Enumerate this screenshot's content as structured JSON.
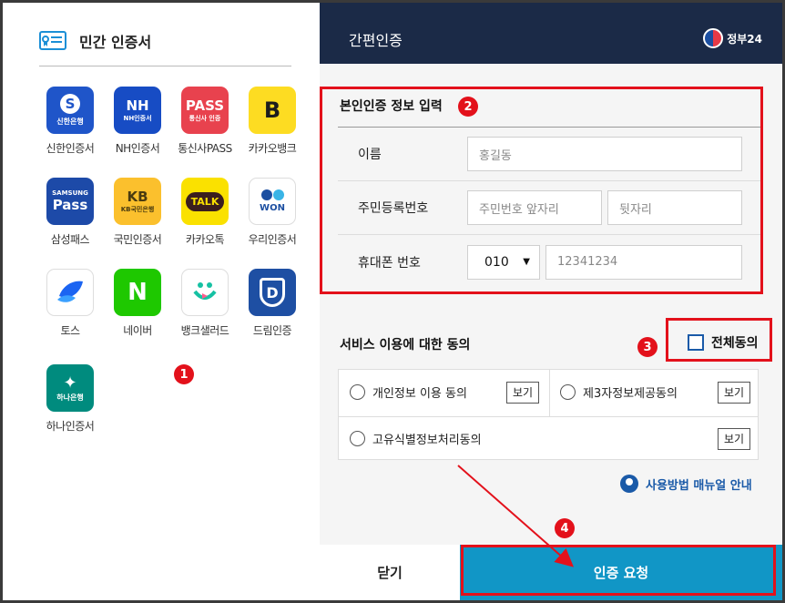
{
  "left": {
    "title": "민간 인증서",
    "apps": [
      {
        "label": "신한인증서",
        "tile_text": "신한은행",
        "color": "#1f55c9",
        "icon": "shinhan-s-icon"
      },
      {
        "label": "NH인증서",
        "tile_text": "NH",
        "sub": "NH인증서",
        "color": "#174cc4",
        "icon": "nh-icon"
      },
      {
        "label": "통신사PASS",
        "tile_text": "PASS",
        "sub": "통신사 인증",
        "color": "#e8424e",
        "icon": "pass-icon"
      },
      {
        "label": "카카오뱅크",
        "tile_text": "B",
        "color": "#fddc22",
        "icon": "kakaobank-icon"
      },
      {
        "label": "삼성패스",
        "tile_text": "Pass",
        "sub": "SAMSUNG",
        "color": "#1d4aa8",
        "icon": "samsung-pass-icon"
      },
      {
        "label": "국민인증서",
        "tile_text": "KB",
        "sub": "KB국민은행",
        "color": "#fbc02d",
        "icon": "kb-icon"
      },
      {
        "label": "카카오톡",
        "tile_text": "TALK",
        "color": "#fae100",
        "icon": "kakaotalk-icon"
      },
      {
        "label": "우리인증서",
        "tile_text": "WON",
        "color": "#ffffff",
        "icon": "woori-won-icon"
      },
      {
        "label": "토스",
        "tile_text": "",
        "color": "#ffffff",
        "icon": "toss-icon"
      },
      {
        "label": "네이버",
        "tile_text": "N",
        "color": "#1ec800",
        "icon": "naver-icon"
      },
      {
        "label": "뱅크샐러드",
        "tile_text": "",
        "color": "#ffffff",
        "icon": "banksalad-icon"
      },
      {
        "label": "드림인증",
        "tile_text": "D",
        "color": "#1e4fa3",
        "icon": "dream-icon"
      },
      {
        "label": "하나인증서",
        "tile_text": "하나은행",
        "color": "#008b7e",
        "icon": "hana-icon"
      }
    ]
  },
  "header": {
    "title": "간편인증",
    "brand": "정부24"
  },
  "form": {
    "title": "본인인증 정보 입력",
    "name_label": "이름",
    "name_placeholder": "홍길동",
    "rrn_label": "주민등록번호",
    "rrn_front_placeholder": "주민번호 앞자리",
    "rrn_back_placeholder": "뒷자리",
    "phone_label": "휴대폰 번호",
    "phone_prefix": "010",
    "phone_value": "12341234"
  },
  "service": {
    "title": "서비스 이용에 대한 동의",
    "all_label": "전체동의",
    "items": [
      "개인정보 이용 동의",
      "제3자정보제공동의",
      "고유식별정보처리동의"
    ],
    "view_label": "보기"
  },
  "manual": "사용방법 매뉴얼 안내",
  "buttons": {
    "close": "닫기",
    "request": "인증 요청"
  },
  "annotations": {
    "colors": {
      "red": "#e3111b"
    },
    "badges": [
      "1",
      "2",
      "3",
      "4"
    ]
  }
}
